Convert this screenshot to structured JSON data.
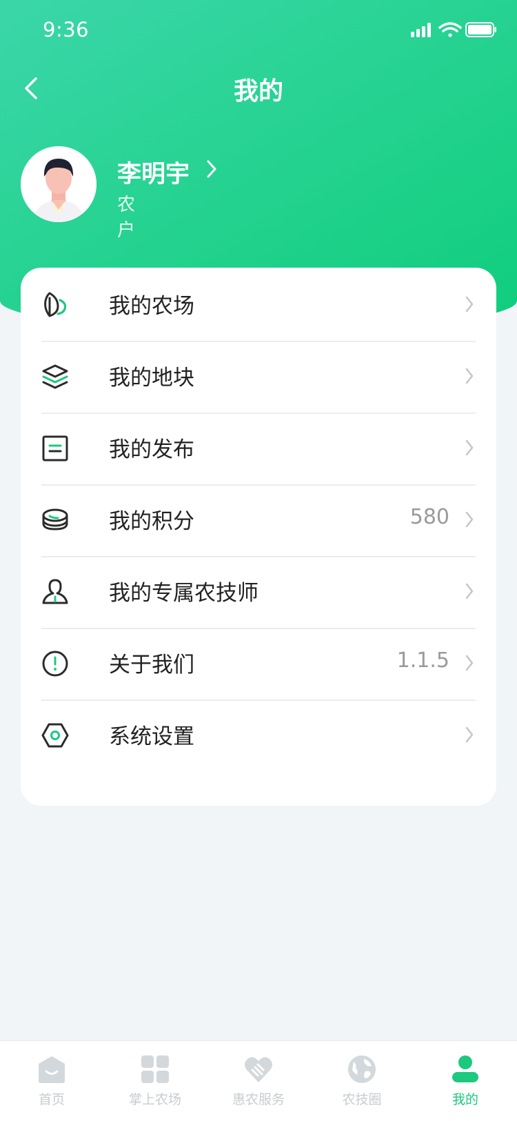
{
  "status_bar": {
    "time": "9:36"
  },
  "header": {
    "title": "我的"
  },
  "profile": {
    "name": "李明宇",
    "role": "农户"
  },
  "menu": [
    {
      "label": "我的农场",
      "value": "",
      "icon": "leaf-icon"
    },
    {
      "label": "我的地块",
      "value": "",
      "icon": "layers-icon"
    },
    {
      "label": "我的发布",
      "value": "",
      "icon": "document-icon"
    },
    {
      "label": "我的积分",
      "value": "580",
      "icon": "coins-icon"
    },
    {
      "label": "我的专属农技师",
      "value": "",
      "icon": "person-icon"
    },
    {
      "label": "关于我们",
      "value": "1.1.5",
      "icon": "info-icon"
    },
    {
      "label": "系统设置",
      "value": "",
      "icon": "settings-icon"
    }
  ],
  "tabbar": [
    {
      "label": "首页",
      "icon": "home-icon",
      "active": false
    },
    {
      "label": "掌上农场",
      "icon": "grid-icon",
      "active": false
    },
    {
      "label": "惠农服务",
      "icon": "heart-hand-icon",
      "active": false
    },
    {
      "label": "农技圈",
      "icon": "globe-icon",
      "active": false
    },
    {
      "label": "我的",
      "icon": "user-icon",
      "active": true
    }
  ],
  "colors": {
    "accent": "#1cc97f",
    "header_gradient_start": "#3bd6a9",
    "header_gradient_end": "#0fcd7d",
    "background": "#f1f5f8"
  }
}
